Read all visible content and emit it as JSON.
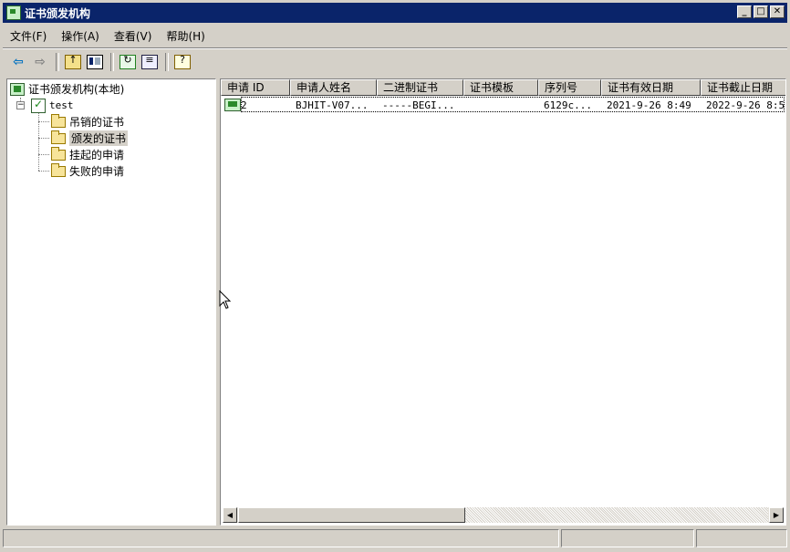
{
  "window": {
    "title": "证书颁发机构",
    "controls": [
      "_",
      "□",
      "✕"
    ]
  },
  "menu": [
    "文件(F)",
    "操作(A)",
    "查看(V)",
    "帮助(H)"
  ],
  "tree": {
    "root": "证书颁发机构(本地)",
    "ca": "test",
    "expander": "−",
    "children": [
      "吊销的证书",
      "颁发的证书",
      "挂起的申请",
      "失败的申请"
    ],
    "selected": "颁发的证书"
  },
  "list": {
    "columns": [
      "申请 ID",
      "申请人姓名",
      "二进制证书",
      "证书模板",
      "序列号",
      "证书有效日期",
      "证书截止日期"
    ],
    "rows": [
      {
        "request_id": "2",
        "requester": "BJHIT-V07...",
        "binary_cert": "-----BEGI...",
        "template": "",
        "serial": "6129c...",
        "valid_from": "2021-9-26 8:49",
        "valid_to": "2022-9-26 8:5"
      }
    ]
  },
  "scrollbar": {
    "left_arrow": "◀",
    "right_arrow": "▶"
  }
}
